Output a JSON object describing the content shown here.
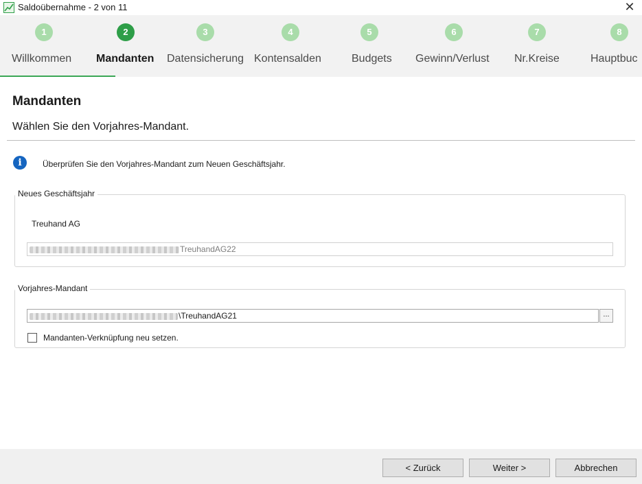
{
  "window": {
    "title": "Saldoübernahme - 2 von 11",
    "close_glyph": "✕"
  },
  "steps": [
    {
      "number": "1",
      "label": "Willkommen",
      "active": false
    },
    {
      "number": "2",
      "label": "Mandanten",
      "active": true
    },
    {
      "number": "3",
      "label": "Datensicherung",
      "active": false
    },
    {
      "number": "4",
      "label": "Kontensalden",
      "active": false
    },
    {
      "number": "5",
      "label": "Budgets",
      "active": false
    },
    {
      "number": "6",
      "label": "Gewinn/Verlust",
      "active": false
    },
    {
      "number": "7",
      "label": "Nr.Kreise",
      "active": false
    },
    {
      "number": "8",
      "label": "Hauptbuc",
      "active": false
    }
  ],
  "header": {
    "title": "Mandanten",
    "subtitle": "Wählen Sie den Vorjahres-Mandant."
  },
  "info": {
    "icon": "info-icon",
    "text": "Überprüfen Sie den Vorjahres-Mandant zum Neuen Geschäftsjahr."
  },
  "new_year": {
    "legend": "Neues Geschäftsjahr",
    "company": "Treuhand AG",
    "path_suffix": "TreuhandAG22"
  },
  "previous_year": {
    "legend": "Vorjahres-Mandant",
    "path_suffix": "\\TreuhandAG21",
    "browse_label": "...",
    "checkbox_label": "Mandanten-Verknüpfung neu setzen.",
    "checkbox_checked": false
  },
  "footer": {
    "back_label": "< Zurück",
    "next_label": "Weiter >",
    "cancel_label": "Abbrechen"
  },
  "colors": {
    "accent": "#2e9e48",
    "step_inactive": "#a9dcaa",
    "info": "#1565c0"
  }
}
